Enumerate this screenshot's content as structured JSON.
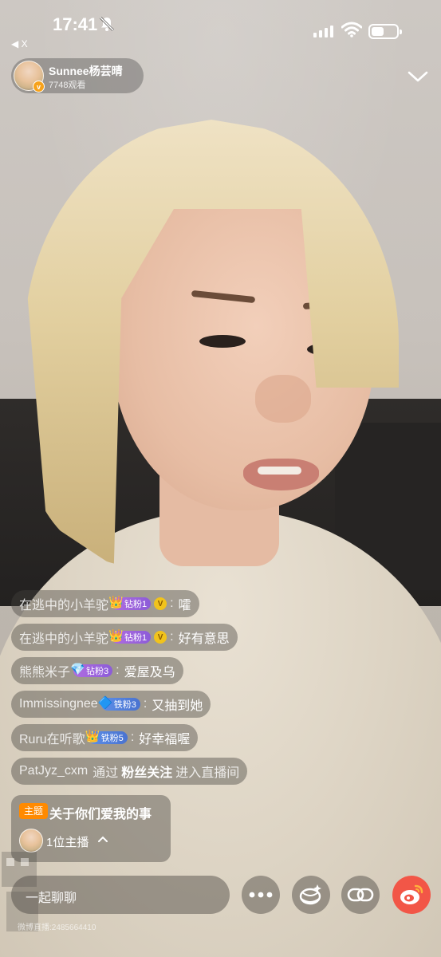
{
  "status_bar": {
    "time": "17:41",
    "back_label": "◀ X",
    "battery_level_percent": 50
  },
  "streamer": {
    "name": "Sunnee杨芸晴",
    "viewers": "7748观看",
    "verified_mark": "v"
  },
  "comments": [
    {
      "user": "在逃中的小羊驼",
      "badge": "钻粉1",
      "badge_type": "zuan",
      "vip": "V",
      "text": "嚯"
    },
    {
      "user": "在逃中的小羊驼",
      "badge": "钻粉1",
      "badge_type": "zuan",
      "vip": "V",
      "text": "好有意思"
    },
    {
      "user": "熊熊米子",
      "badge": "钻粉3",
      "badge_type": "zuan",
      "text": "爱屋及乌"
    },
    {
      "user": "Immissingnee",
      "badge": "铁粉3",
      "badge_type": "tie",
      "text": "又抽到她"
    },
    {
      "user": "Ruru在听歌",
      "badge": "铁粉5",
      "badge_type": "tie",
      "text": "好幸福喔"
    }
  ],
  "join_notice": {
    "user": "PatJyz_cxm",
    "via": "通过",
    "source": "粉丝关注",
    "action": "进入直播间"
  },
  "topic": {
    "tag": "主题",
    "title": "关于你们爱我的事",
    "host_count": "1位主播"
  },
  "bottom_bar": {
    "chat_placeholder": "一起聊聊",
    "footer_id": "微博直播:2485664410"
  },
  "icons": {
    "bell": "bell-muted-icon",
    "more": "more-dots-icon",
    "gift": "gift-icon",
    "link": "link-icon",
    "weibo": "weibo-icon",
    "collapse": "chevron-down-icon"
  },
  "colors": {
    "topic_tag": "#ff8a00",
    "zuan_badge": "#9b64dc",
    "tie_badge": "#5383de",
    "weibo_red": "#f25647"
  }
}
